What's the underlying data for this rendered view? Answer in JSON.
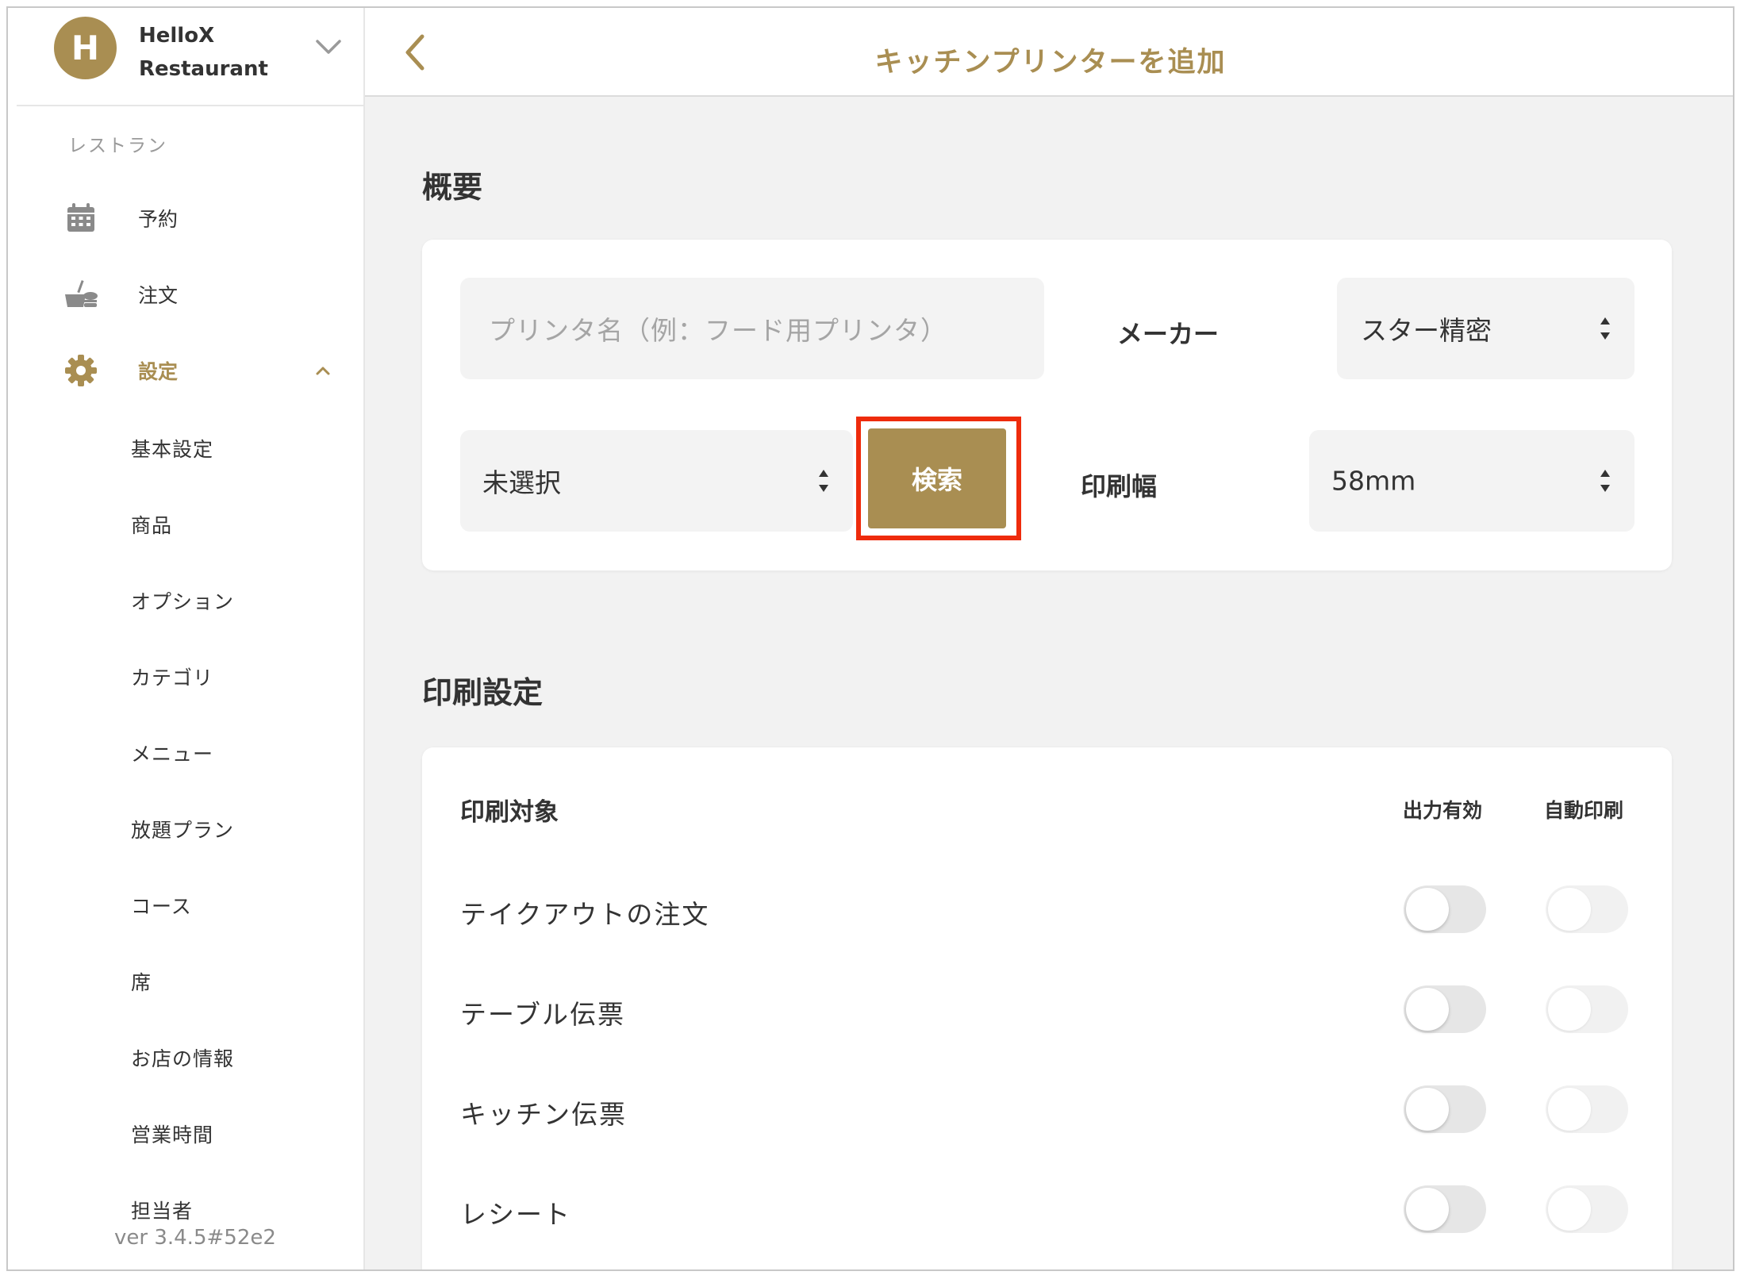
{
  "brand": {
    "avatar_letter": "H",
    "name_line1": "HelloX",
    "name_line2": "Restaurant"
  },
  "sidebar": {
    "section_label": "レストラン",
    "items": [
      {
        "label": "予約",
        "icon": "calendar-icon"
      },
      {
        "label": "注文",
        "icon": "food-icon"
      },
      {
        "label": "設定",
        "icon": "gear-icon",
        "active": true,
        "expanded": true
      }
    ],
    "sub_items": [
      "基本設定",
      "商品",
      "オプション",
      "カテゴリ",
      "メニュー",
      "放題プラン",
      "コース",
      "席",
      "お店の情報",
      "営業時間",
      "担当者"
    ],
    "version": "ver 3.4.5#52e2"
  },
  "header": {
    "title": "キッチンプリンターを追加"
  },
  "overview": {
    "heading": "概要",
    "printer_name_placeholder": "プリンタ名（例：フード用プリンタ）",
    "maker_label": "メーカー",
    "maker_value": "スター精密",
    "model_value": "未選択",
    "search_button": "検索",
    "width_label": "印刷幅",
    "width_value": "58mm"
  },
  "print_settings": {
    "heading": "印刷設定",
    "target_header": "印刷対象",
    "output_header": "出力有効",
    "auto_header": "自動印刷",
    "rows": [
      {
        "label": "テイクアウトの注文",
        "output_enabled": false,
        "auto_print": false
      },
      {
        "label": "テーブル伝票",
        "output_enabled": false,
        "auto_print": false
      },
      {
        "label": "キッチン伝票",
        "output_enabled": false,
        "auto_print": false
      },
      {
        "label": "レシート",
        "output_enabled": false,
        "auto_print": false
      }
    ]
  },
  "colors": {
    "accent": "#a98e52",
    "highlight": "#ee2b0c",
    "background": "#f2f2f2"
  }
}
